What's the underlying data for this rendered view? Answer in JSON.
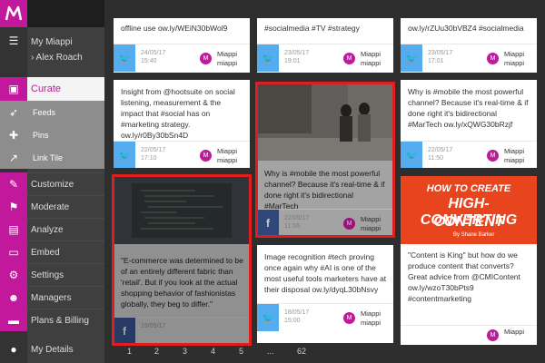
{
  "colors": {
    "accent": "#c2189b",
    "twitter": "#55acee",
    "facebook": "#3b5998",
    "highlight": "#e01e1e"
  },
  "sidebar": {
    "account": "My Miappi",
    "user": "› Alex Roach",
    "curate": "Curate",
    "sub": [
      "Feeds",
      "Pins",
      "Link Tile"
    ],
    "items": [
      "Customize",
      "Moderate",
      "Analyze",
      "Embed",
      "Settings",
      "Managers",
      "Plans & Billing",
      "My Details"
    ]
  },
  "cards": {
    "c1": {
      "text": "offline use ow.ly/WEiN30bWol9",
      "date": "24/05/17",
      "time": "15:40"
    },
    "c2": {
      "text": "#socialmedia #TV #strategy",
      "date": "23/05/17",
      "time": "19:01"
    },
    "c3": {
      "text": "ow.ly/rZUu30bVBZ4 #socialmedia",
      "date": "23/05/17",
      "time": "17:01"
    },
    "c4": {
      "text": "Insight from @hootsuite on social listening, measurement & the impact that #social has on #marketing strategy. ow.ly/r0By30bSn4D",
      "date": "22/05/17",
      "time": "17:10"
    },
    "c5": {
      "text": "Why is #mobile the most powerful channel? Because it's real-time & if done right it's bidirectional #MarTech",
      "date": "22/05/17",
      "time": "11:55"
    },
    "c6": {
      "text": "Why is #mobile the most powerful channel? Because it's real-time & if done right it's bidirectional #MarTech ow.ly/xQWG30bRzjf",
      "date": "22/05/17",
      "time": "11:50"
    },
    "c7": {
      "text": "\"E-commerce was determined to be of an entirely different fabric than 'retail'. But if you look at the actual shopping behavior of fashionistas globally, they beg to differ.\"",
      "date": "19/05/17",
      "time": ""
    },
    "c8": {
      "text": "Image recognition #tech proving once again why #AI is one of the most useful tools marketers have at their disposal ow.ly/dyqL30bNsvy",
      "date": "18/05/17",
      "time": "15:00"
    },
    "c9": {
      "text": "\"Content is King\" but how do we produce content that converts? Great advice from @CMIContent ow.ly/wzoT30bPts9 #contentmarketing",
      "date": "",
      "time": ""
    }
  },
  "author": "Miappi miappi",
  "author_line2": "miappi",
  "author_short": "Miappi",
  "banner": {
    "line1": "HOW TO CREATE",
    "line2": "HIGH-CONVERTING",
    "line3": "CONTENT",
    "byline": "By Shane Barker"
  },
  "pagination": {
    "p1": "1",
    "p2": "2",
    "p3": "3",
    "p4": "4",
    "p5": "5",
    "ellipsis": "...",
    "last": "62"
  }
}
